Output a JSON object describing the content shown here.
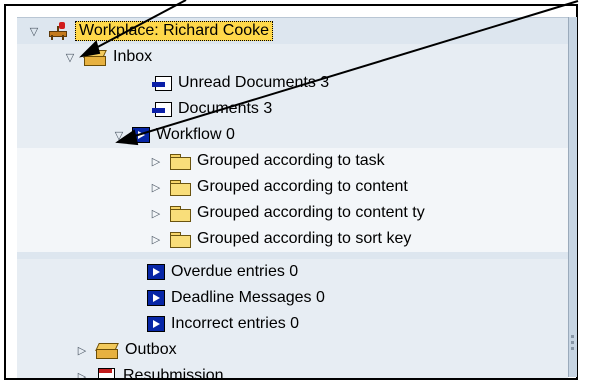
{
  "tree": {
    "root": {
      "label": "Workplace: Richard Cooke",
      "toggle": "expanded"
    },
    "inbox": {
      "label": "Inbox",
      "toggle": "expanded"
    },
    "inbox_items": [
      {
        "label": "Unread Documents 3"
      },
      {
        "label": "Documents 3"
      }
    ],
    "workflow": {
      "label": "Workflow 0",
      "toggle": "expanded"
    },
    "workflow_groups": [
      {
        "label": "Grouped according to task"
      },
      {
        "label": "Grouped according to content"
      },
      {
        "label": "Grouped according to content ty"
      },
      {
        "label": "Grouped according to sort key"
      }
    ],
    "inbox_tail": [
      {
        "label": "Overdue entries 0"
      },
      {
        "label": "Deadline Messages 0"
      },
      {
        "label": "Incorrect entries 0"
      }
    ],
    "outbox": {
      "label": "Outbox",
      "toggle": "collapsed"
    },
    "resubmission": {
      "label": "Resubmission",
      "toggle": "collapsed"
    }
  },
  "icons": {
    "toggle_expanded": "triangle-down",
    "toggle_collapsed": "triangle-right",
    "root": "workplace-desk-icon",
    "box": "inbox-box-icon",
    "document": "document-icon",
    "workflow": "workflow-icon",
    "folder": "folder-icon"
  },
  "colors": {
    "pane_bg": "#dde6ef",
    "selection": "#ffd84a",
    "workflow_blue": "#0726a6"
  }
}
